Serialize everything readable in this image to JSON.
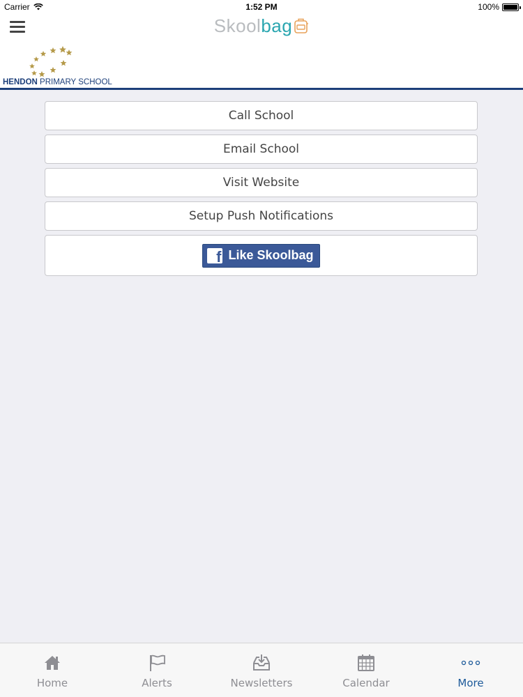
{
  "status_bar": {
    "carrier": "Carrier",
    "time": "1:52 PM",
    "battery": "100%"
  },
  "nav": {
    "brand_part1": "Skool",
    "brand_part2": "bag",
    "menu_icon": "hamburger-menu-icon"
  },
  "school": {
    "name_bold": "HENDON",
    "name_rest": " PRIMARY SCHOOL"
  },
  "actions": [
    {
      "label": "Call School"
    },
    {
      "label": "Email School"
    },
    {
      "label": "Visit Website"
    },
    {
      "label": "Setup Push Notifications"
    }
  ],
  "facebook": {
    "label": "Like Skoolbag",
    "color": "#3b5998"
  },
  "tabs": [
    {
      "label": "Home",
      "icon": "home-icon"
    },
    {
      "label": "Alerts",
      "icon": "flag-icon"
    },
    {
      "label": "Newsletters",
      "icon": "inbox-download-icon"
    },
    {
      "label": "Calendar",
      "icon": "calendar-icon"
    },
    {
      "label": "More",
      "icon": "more-dots-icon",
      "active": true
    }
  ],
  "colors": {
    "accent": "#1d5a9a",
    "brand_teal": "#2aa6b0",
    "school_blue": "#1d3f7a",
    "star_gold": "#b59a4a"
  }
}
